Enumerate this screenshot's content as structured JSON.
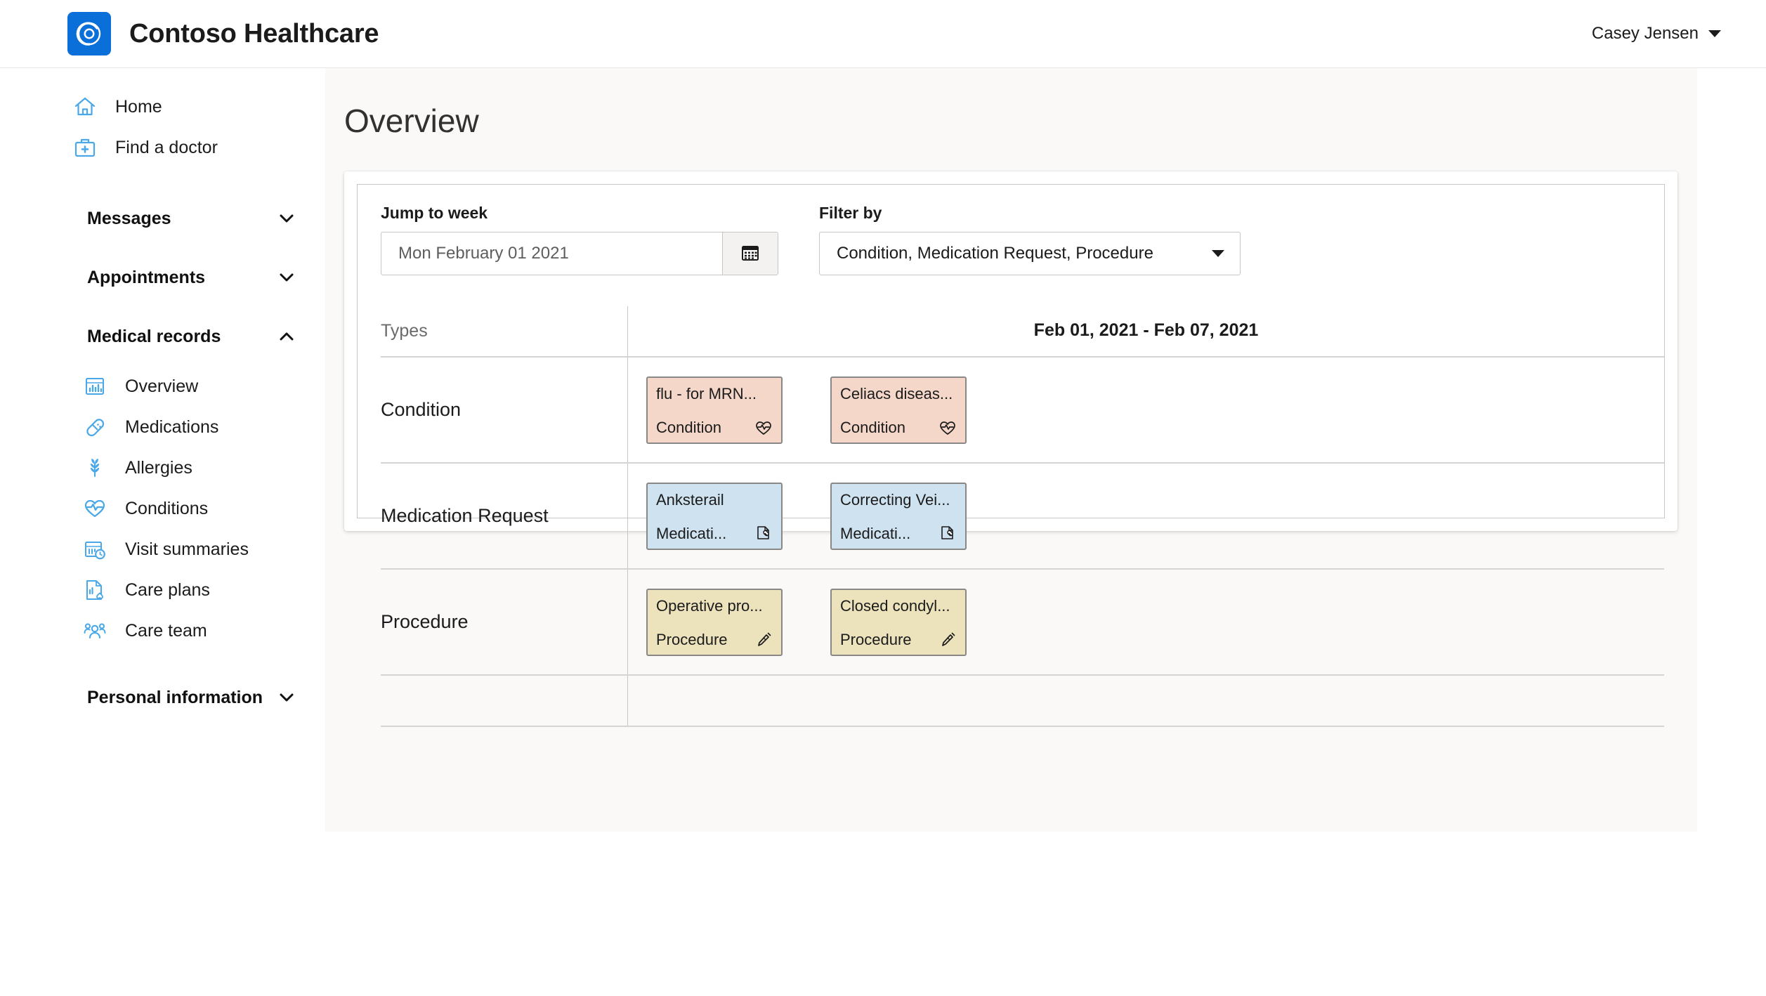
{
  "header": {
    "brand_title": "Contoso Healthcare",
    "logo_icon": "contoso-swirl-logo",
    "user_name": "Casey Jensen",
    "user_caret_icon": "caret-down-icon"
  },
  "sidebar": {
    "top_items": [
      {
        "label": "Home",
        "icon": "home-icon"
      },
      {
        "label": "Find a doctor",
        "icon": "doctor-bag-icon"
      }
    ],
    "sections": [
      {
        "label": "Messages",
        "chevron": "chevron-down-icon",
        "expanded": false
      },
      {
        "label": "Appointments",
        "chevron": "chevron-down-icon",
        "expanded": false
      },
      {
        "label": "Medical records",
        "chevron": "chevron-up-icon",
        "expanded": true
      },
      {
        "label": "Personal information",
        "chevron": "chevron-down-icon",
        "expanded": false
      }
    ],
    "medical_records_items": [
      {
        "label": "Overview",
        "icon": "chart-report-icon"
      },
      {
        "label": "Medications",
        "icon": "pill-capsule-icon"
      },
      {
        "label": "Allergies",
        "icon": "wheat-allergen-icon"
      },
      {
        "label": "Conditions",
        "icon": "heart-pulse-icon"
      },
      {
        "label": "Visit summaries",
        "icon": "calendar-clock-icon"
      },
      {
        "label": "Care plans",
        "icon": "document-heart-icon"
      },
      {
        "label": "Care team",
        "icon": "people-group-icon"
      }
    ]
  },
  "main": {
    "page_title": "Overview",
    "controls": {
      "jump_to_week": {
        "label": "Jump to week",
        "value": "Mon February 01 2021",
        "calendar_icon": "calendar-icon"
      },
      "filter_by": {
        "label": "Filter by",
        "value": "Condition, Medication Request, Procedure",
        "caret_icon": "caret-down-icon"
      }
    },
    "timeline": {
      "types_header": "Types",
      "date_range": "Feb 01, 2021 - Feb 07, 2021",
      "rows": [
        {
          "label": "Condition",
          "color": "#f4d7c8",
          "style": "c-condition",
          "events": [
            {
              "title": "flu - for MRN...",
              "type": "Condition",
              "icon": "heart-pulse-icon",
              "pos": "pos-a"
            },
            {
              "title": "Celiacs diseas...",
              "type": "Condition",
              "icon": "heart-pulse-icon",
              "pos": "pos-b"
            }
          ]
        },
        {
          "label": "Medication Request",
          "color": "#cfe2f0",
          "style": "c-medication",
          "events": [
            {
              "title": "Anksterail",
              "type": "Medicati...",
              "icon": "document-pill-icon",
              "pos": "pos-a"
            },
            {
              "title": "Correcting Vei...",
              "type": "Medicati...",
              "icon": "document-pill-icon",
              "pos": "pos-b"
            }
          ]
        },
        {
          "label": "Procedure",
          "color": "#ece3bd",
          "style": "c-procedure",
          "events": [
            {
              "title": "Operative pro...",
              "type": "Procedure",
              "icon": "syringe-icon",
              "pos": "pos-a"
            },
            {
              "title": "Closed condyl...",
              "type": "Procedure",
              "icon": "syringe-icon",
              "pos": "pos-b"
            }
          ]
        }
      ]
    }
  },
  "colors": {
    "brand_blue": "#0a6fd8",
    "icon_blue": "#4aa8e8",
    "page_bg": "#faf9f8",
    "border": "#c8c6c4",
    "condition": "#f4d7c8",
    "medication": "#cfe2f0",
    "procedure": "#ece3bd"
  }
}
